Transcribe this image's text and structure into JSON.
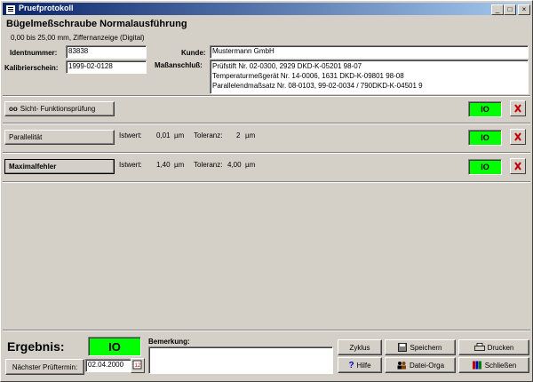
{
  "window": {
    "title": "Pruefprotokoll",
    "minimize": "_",
    "maximize": "□",
    "close": "×"
  },
  "header": {
    "title": "Bügelmeßschraube Normalausführung",
    "range": "0,00 bis    25,00 mm, Ziffernanzeige (Digital)",
    "ident_label": "Identnummer:",
    "ident_value": "83838",
    "kalib_label": "Kalibrierschein:",
    "kalib_value": "1999-02-0128",
    "kunde_label": "Kunde:",
    "kunde_value": "Mustermann GmbH",
    "mass_label": "Maßanschluß:",
    "mass_lines": [
      "Prüfstift Nr. 02-0300, 2929 DKD-K-05201 98-07",
      "Temperaturmeßgerät Nr. 14-0006, 1631 DKD-K-09801 98-08",
      "Parallelendmaßsatz Nr. 08-0103, 99-02-0034 / 790DKD-K-04501 9"
    ]
  },
  "checks": [
    {
      "label": "Sicht- Funktionsprüfung",
      "result": "IO"
    },
    {
      "label": "Parallelität",
      "istwert_label": "Istwert:",
      "istwert": "0,01",
      "unit1": "µm",
      "tol_label": "Toleranz:",
      "toleranz": "2",
      "unit2": "µm",
      "result": "IO"
    },
    {
      "label": "Maximalfehler",
      "istwert_label": "Istwert:",
      "istwert": "1,40",
      "unit1": "µm",
      "tol_label": "Toleranz:",
      "toleranz": "4,00",
      "unit2": "µm",
      "result": "IO"
    }
  ],
  "footer": {
    "ergebnis_label": "Ergebnis:",
    "ergebnis_value": "IO",
    "next_label": "Nächster Prüftermin:",
    "next_date": "02.04.2000",
    "bemerkung_label": "Bemerkung:",
    "buttons": {
      "zyklus": "Zyklus",
      "speichern": "Speichern",
      "drucken": "Drucken",
      "hilfe": "Hilfe",
      "datei_orga": "Datei-Orga",
      "schliessen": "Schließen"
    }
  },
  "colors": {
    "ok": "#00ff00",
    "face": "#d4d0c8",
    "title_start": "#0a246a",
    "title_end": "#a6caf0",
    "x_red": "#c00000"
  }
}
